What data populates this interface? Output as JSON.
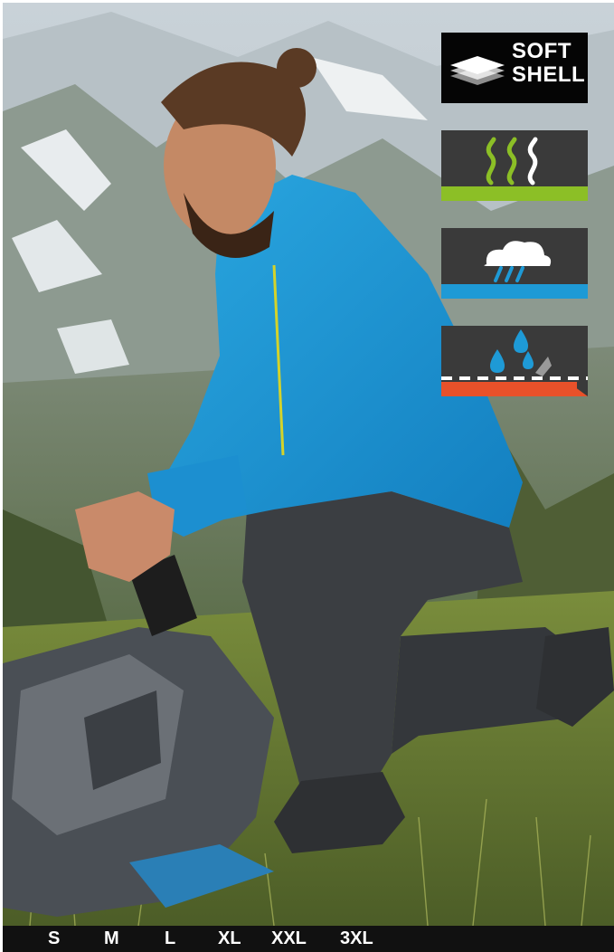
{
  "badges": {
    "softshell": {
      "line1": "SOFT",
      "line2": "SHELL",
      "icon": "softshell-layers-icon"
    },
    "breathable": {
      "icon": "breathable-steam-icon",
      "accent": "#8cbf26"
    },
    "waterproof": {
      "icon": "rain-cloud-icon",
      "accent": "#1e9ad6"
    },
    "water_repellent": {
      "icon": "water-drops-repellent-icon",
      "accent": "#e8512a"
    }
  },
  "sizes": [
    "S",
    "M",
    "L",
    "XL",
    "XXL",
    "3XL"
  ]
}
